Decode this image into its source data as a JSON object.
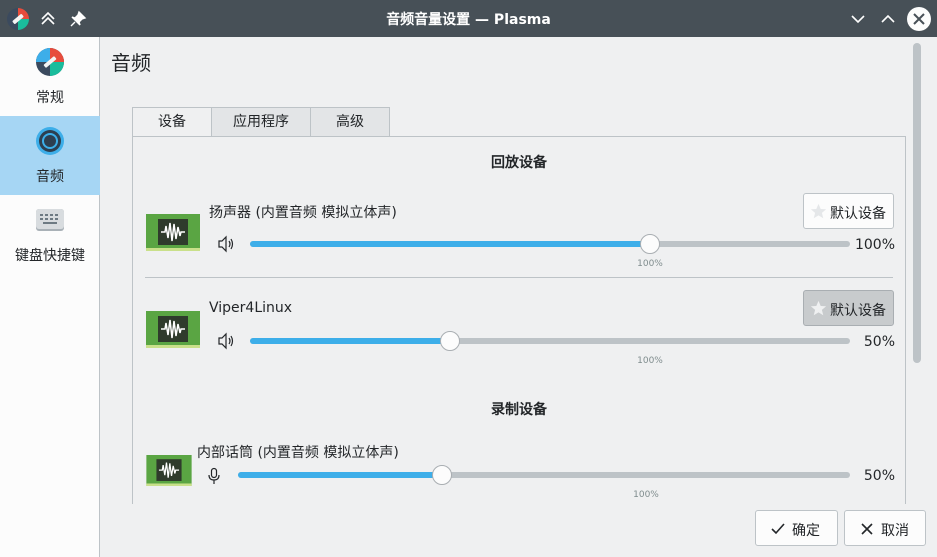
{
  "window": {
    "title": "音频音量设置 — Plasma"
  },
  "sidebar": {
    "items": [
      {
        "label": "常规",
        "icon": "general-settings-icon"
      },
      {
        "label": "音频",
        "icon": "audio-icon",
        "active": true
      },
      {
        "label": "键盘快捷键",
        "icon": "keyboard-icon"
      }
    ]
  },
  "page": {
    "title": "音频"
  },
  "tabs": [
    {
      "label": "设备",
      "active": true
    },
    {
      "label": "应用程序"
    },
    {
      "label": "高级"
    }
  ],
  "playback": {
    "title": "回放设备",
    "devices": [
      {
        "name": "扬声器 (内置音频 模拟立体声)",
        "volume_label": "100%",
        "volume": 1.0,
        "tick_label": "100%",
        "default_label": "默认设备",
        "is_default": false
      },
      {
        "name": "Viper4Linux",
        "volume_label": "50%",
        "volume": 0.5,
        "tick_label": "100%",
        "default_label": "默认设备",
        "is_default": true
      }
    ]
  },
  "recording": {
    "title": "录制设备",
    "devices": [
      {
        "name": "内部话筒 (内置音频 模拟立体声)",
        "volume_label": "50%",
        "volume": 0.5,
        "tick_label": "100%"
      }
    ]
  },
  "footer": {
    "ok_label": "确定",
    "cancel_label": "取消"
  },
  "colors": {
    "accent": "#3daee9",
    "titlebar": "#475057",
    "device_icon": "#5aa543"
  }
}
